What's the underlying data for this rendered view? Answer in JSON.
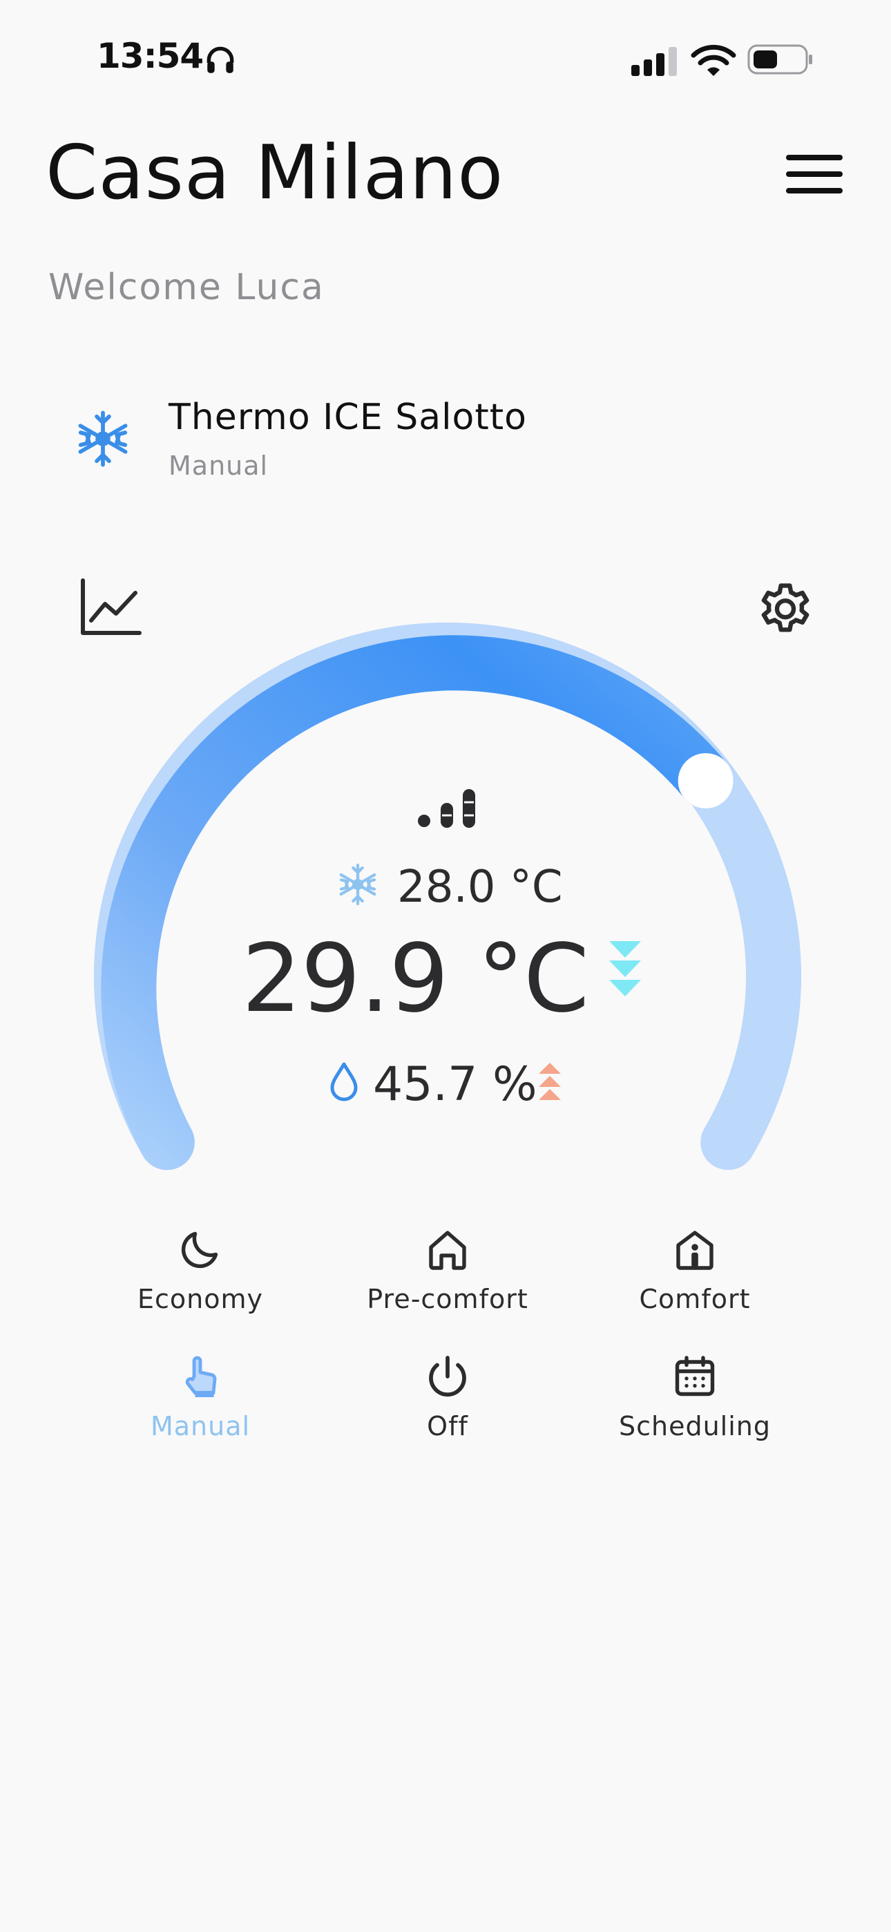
{
  "status_bar": {
    "time": "13:54",
    "icons": [
      "headphones-icon",
      "cellular-signal-icon",
      "wifi-icon",
      "battery-icon"
    ]
  },
  "header": {
    "title": "Casa Milano",
    "welcome": "Welcome Luca",
    "menu_icon": "hamburger-menu-icon"
  },
  "device": {
    "name": "Thermo ICE Salotto",
    "mode": "Manual",
    "icon": "snowflake-icon"
  },
  "gauge": {
    "setpoint": "28.0 °C",
    "temperature": "29.9 °C",
    "humidity": "45.7 %",
    "fan_level_icon": "fan-speed-icon",
    "temp_trend_icon": "trend-down-icon",
    "humidity_trend_icon": "trend-up-icon",
    "colors": {
      "accent": "#4a9cf7",
      "track_light": "#bcd8fb",
      "cyan": "#7fe8f5",
      "salmon": "#f4a58a"
    }
  },
  "toolbar": {
    "chart_icon": "line-chart-icon",
    "settings_icon": "gear-icon"
  },
  "modes": [
    {
      "label": "Economy",
      "icon": "moon-icon"
    },
    {
      "label": "Pre-comfort",
      "icon": "home-icon"
    },
    {
      "label": "Comfort",
      "icon": "home-person-icon"
    },
    {
      "label": "Manual",
      "icon": "hand-pointer-icon",
      "active": true
    },
    {
      "label": "Off",
      "icon": "power-icon"
    },
    {
      "label": "Scheduling",
      "icon": "calendar-icon"
    }
  ]
}
